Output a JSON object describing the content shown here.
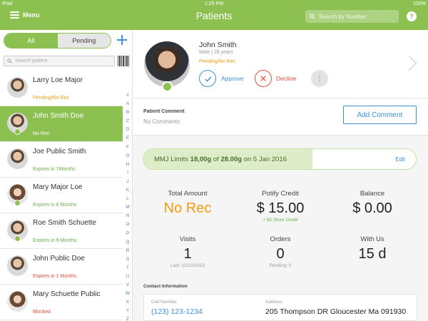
{
  "statusbar": {
    "carrier": "iPad",
    "time": "1:25 PM",
    "battery": "100%"
  },
  "header": {
    "menu_label": "Menu",
    "title": "Patients",
    "search_placeholder": "Search by Number",
    "help_label": "?"
  },
  "tabs": {
    "all": "All",
    "pending": "Pending"
  },
  "patient_search_placeholder": "Search patient",
  "patients": [
    {
      "name": "Larry Loe Major",
      "status": "Pending/No Rec",
      "status_color": "#f39c12",
      "verified": false,
      "gender": "male"
    },
    {
      "name": "John Smith Doe",
      "status": "No Rec",
      "status_color": "#ffffff",
      "verified": true,
      "gender": "male",
      "selected": true
    },
    {
      "name": "Joe Public Smith",
      "status": "Expires in 7Months",
      "status_color": "#6ab04c",
      "verified": false,
      "gender": "male"
    },
    {
      "name": "Mary Major Loe",
      "status": "Expires in 6 Months",
      "status_color": "#6ab04c",
      "verified": true,
      "gender": "female"
    },
    {
      "name": "Roe Smith Schuette",
      "status": "Expires in 9 Months",
      "status_color": "#6ab04c",
      "verified": true,
      "gender": "male"
    },
    {
      "name": "John Public Doe",
      "status": "Expires in 1 Months",
      "status_color": "#e74c3c",
      "verified": false,
      "gender": "male"
    },
    {
      "name": "Mary Schuette Public",
      "status": "Blocked",
      "status_color": "#e74c3c",
      "verified": false,
      "gender": "female"
    }
  ],
  "alphabet": [
    "#",
    "A",
    "B",
    "C",
    "D",
    "E",
    "F",
    "G",
    "H",
    "I",
    "J",
    "K",
    "L",
    "M",
    "N",
    "O",
    "P",
    "Q",
    "R",
    "S",
    "T",
    "U",
    "V",
    "W",
    "X",
    "Y",
    "Z"
  ],
  "profile": {
    "name": "John Smith",
    "meta": "Male | 28 years",
    "status": "Pending/No Rec",
    "approve_label": "Approve",
    "decline_label": "Decline",
    "more_label": "⋮"
  },
  "comment": {
    "label": "Patient Comment",
    "value": "No Comments",
    "add_button": "Add Comment"
  },
  "mmj": {
    "prefix": "MMJ Limits",
    "used": "18,00g",
    "of_word": "of",
    "limit": "28.00g",
    "date_prefix": "on 5 Jan 2016",
    "edit": "Edit",
    "fill_fraction": 0.62
  },
  "stats": {
    "total_amount": {
      "label": "Total Amount",
      "value": "No Rec"
    },
    "potify_credit": {
      "label": "Potify Credit",
      "value": "$ 15.00",
      "sub": "+ $5 Store Credit"
    },
    "balance": {
      "label": "Balance",
      "value": "$ 0.00"
    },
    "visits": {
      "label": "Visits",
      "value": "1",
      "sub": "Last: 12/10/2015"
    },
    "orders": {
      "label": "Orders",
      "value": "0",
      "sub": "Pending: 0"
    },
    "with_us": {
      "label": "With Us",
      "value": "15 d"
    }
  },
  "contact": {
    "section_label": "Contact Information",
    "cell_label": "Cell Number",
    "cell_value": "(123) 123-1234",
    "address_label": "Address",
    "address_value": "205 Thompson DR Gloucester Ma 091930"
  }
}
